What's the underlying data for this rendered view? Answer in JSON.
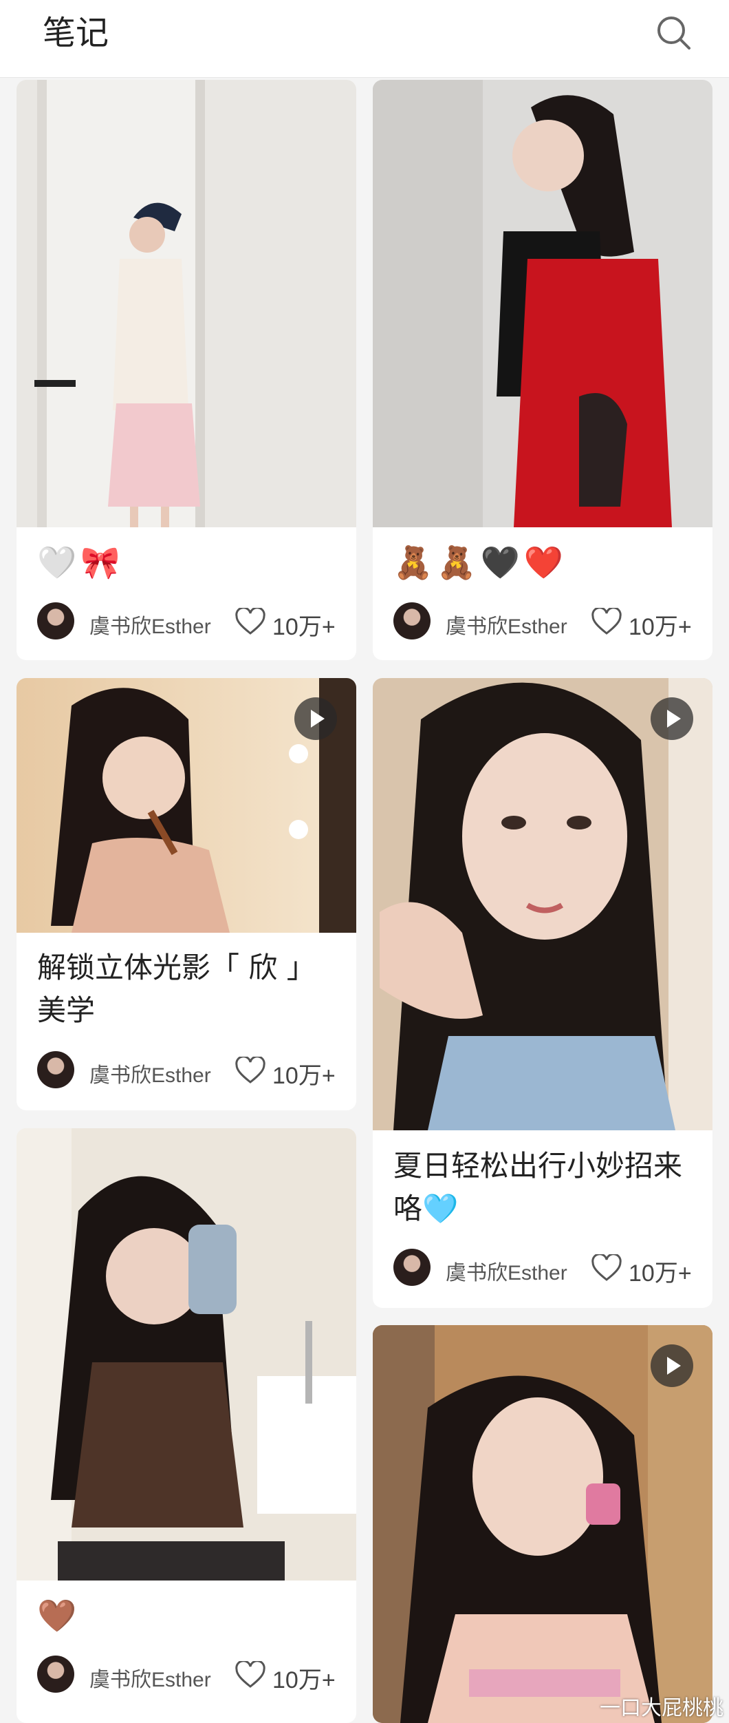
{
  "header": {
    "title": "笔记",
    "search_icon": "search-icon"
  },
  "cards": [
    {
      "caption": "🤍🎀",
      "author": "虞书欣Esther",
      "likes": "10万+",
      "video": false
    },
    {
      "caption": "🧸🧸🖤❤️",
      "author": "虞书欣Esther",
      "likes": "10万+",
      "video": false
    },
    {
      "caption": "解锁立体光影「 欣 」美学",
      "author": "虞书欣Esther",
      "likes": "10万+",
      "video": true
    },
    {
      "caption": "夏日轻松出行小妙招来咯🩵",
      "author": "虞书欣Esther",
      "likes": "10万+",
      "video": true
    },
    {
      "caption": "🤎",
      "author": "虞书欣Esther",
      "likes": "10万+",
      "video": false
    },
    {
      "caption": "",
      "author": "",
      "likes": "",
      "video": true
    }
  ],
  "watermark": "一口大屁桃桃",
  "colors": {
    "background": "#f4f4f4",
    "card": "#ffffff",
    "text": "#222222",
    "meta": "#555555"
  }
}
